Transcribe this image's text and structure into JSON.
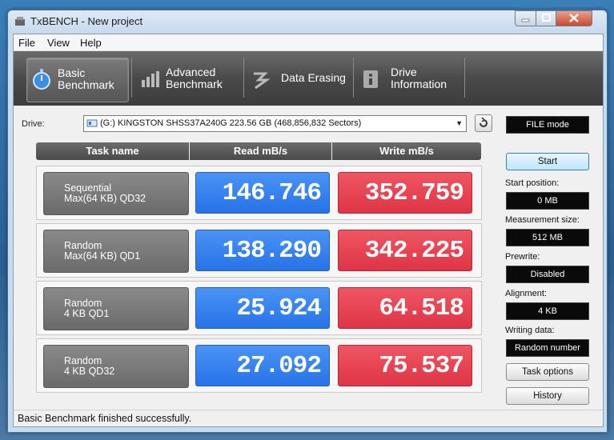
{
  "window": {
    "title": "TxBENCH - New project"
  },
  "menu": [
    "File",
    "View",
    "Help"
  ],
  "toolbar": {
    "basic": {
      "line1": "Basic",
      "line2": "Benchmark"
    },
    "advanced": {
      "line1": "Advanced",
      "line2": "Benchmark"
    },
    "erasing": {
      "line1": "Data Erasing"
    },
    "info": {
      "line1": "Drive",
      "line2": "Information"
    }
  },
  "drive": {
    "label": "Drive:",
    "value": "(G:) KINGSTON SHSS37A240G  223.56 GB (468,856,832 Sectors)"
  },
  "mode": "FILE mode",
  "table": {
    "headers": [
      "Task name",
      "Read mB/s",
      "Write mB/s"
    ],
    "rows": [
      {
        "task_l1": "Sequential",
        "task_l2": "Max(64 KB) QD32",
        "read": "146.746",
        "write": "352.759"
      },
      {
        "task_l1": "Random",
        "task_l2": "Max(64 KB) QD1",
        "read": "138.290",
        "write": "342.225"
      },
      {
        "task_l1": "Random",
        "task_l2": "4 KB QD1",
        "read": "25.924",
        "write": "64.518"
      },
      {
        "task_l1": "Random",
        "task_l2": "4 KB QD32",
        "read": "27.092",
        "write": "75.537"
      }
    ]
  },
  "settings": {
    "start": "Start",
    "start_position_label": "Start position:",
    "start_position": "0 MB",
    "measurement_label": "Measurement size:",
    "measurement": "512 MB",
    "prewrite_label": "Prewrite:",
    "prewrite": "Disabled",
    "alignment_label": "Alignment:",
    "alignment": "4 KB",
    "writing_label": "Writing data:",
    "writing": "Random number",
    "task_options": "Task options",
    "history": "History"
  },
  "status": "Basic Benchmark finished successfully."
}
